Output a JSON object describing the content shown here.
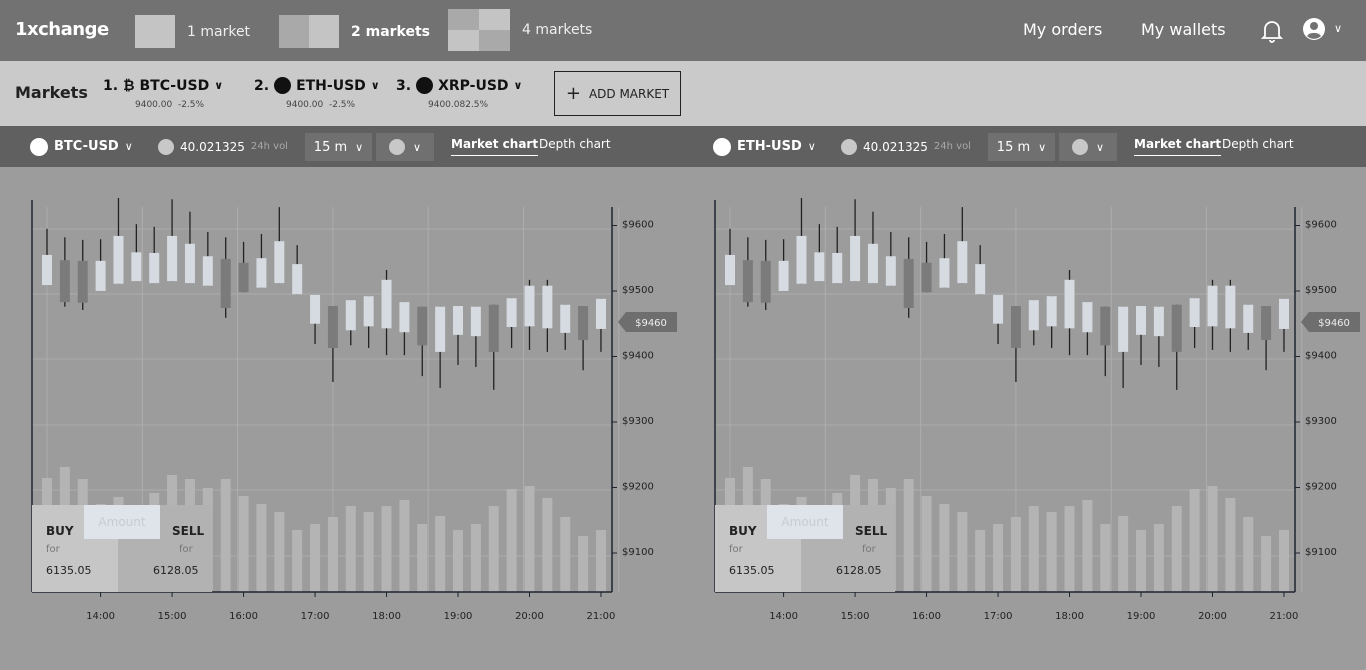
{
  "app": {
    "title": "1xchange"
  },
  "layouts": [
    {
      "label": "1 market"
    },
    {
      "label": "2 markets",
      "active": true
    },
    {
      "label": "4 markets"
    }
  ],
  "nav": {
    "orders": "My orders",
    "wallets": "My wallets",
    "bell_icon": "bell-icon",
    "user_icon": "user-circle-icon"
  },
  "markets": {
    "title": "Markets",
    "items": [
      {
        "index": "1.",
        "icon": "bitcoin-icon",
        "symbol": "₿",
        "pair": "BTC-USD",
        "price": "9400.00",
        "change": "-2.5%"
      },
      {
        "index": "2.",
        "icon": "coin-dot-icon",
        "pair": "ETH-USD",
        "price": "9400.00",
        "change": "-2.5%"
      },
      {
        "index": "3.",
        "icon": "coin-dot-icon",
        "pair": "XRP-USD",
        "price": "9400.08",
        "change": "2.5%"
      }
    ],
    "add_label": "ADD MARKET"
  },
  "colors": {
    "topbar": "#727272",
    "markets_bar": "#cacaca",
    "chart_header": "#606060",
    "background": "#9c9c9c",
    "up_candle": "#d5dbe0",
    "down_candle": "#7b7b7b"
  },
  "panels": [
    {
      "pair": "BTC-USD",
      "volume": "40.021325",
      "volume_label": "24h vol",
      "interval": "15 m",
      "tabs": [
        "Market chart",
        "Depth chart"
      ],
      "active_tab": "Market chart",
      "trade": {
        "buy": "BUY",
        "sell": "SELL",
        "for": "for",
        "buy_price": "6135.05",
        "sell_price": "6128.05",
        "amount_placeholder": "Amount"
      }
    },
    {
      "pair": "ETH-USD",
      "volume": "40.021325",
      "volume_label": "24h vol",
      "interval": "15 m",
      "tabs": [
        "Market chart",
        "Depth chart"
      ],
      "active_tab": "Market chart",
      "trade": {
        "buy": "BUY",
        "sell": "SELL",
        "for": "for",
        "buy_price": "6135.05",
        "sell_price": "6128.05",
        "amount_placeholder": "Amount"
      }
    }
  ],
  "chart_data": [
    {
      "type": "candlestick",
      "pair": "BTC-USD",
      "interval": "15m",
      "current_price_label": "$9460",
      "current_price": 9460,
      "y_ticks": [
        "$9600",
        "$9500",
        "$9400",
        "$9300",
        "$9200",
        "$9100"
      ],
      "y_tick_values": [
        9600,
        9500,
        9400,
        9300,
        9200,
        9100
      ],
      "x_ticks": [
        "14:00",
        "15:00",
        "16:00",
        "17:00",
        "18:00",
        "19:00",
        "20:00",
        "21:00"
      ],
      "first_candle_time": "13:15",
      "grid": true,
      "ohlc": [
        [
          9506,
          9592,
          9506,
          9552
        ],
        [
          9544,
          9579,
          9473,
          9480
        ],
        [
          9543,
          9575,
          9468,
          9479
        ],
        [
          9497,
          9576,
          9497,
          9543
        ],
        [
          9508,
          9639,
          9508,
          9581
        ],
        [
          9512,
          9599,
          9512,
          9556
        ],
        [
          9509,
          9595,
          9509,
          9555
        ],
        [
          9512,
          9637,
          9512,
          9581
        ],
        [
          9509,
          9618,
          9509,
          9569
        ],
        [
          9505,
          9587,
          9505,
          9550
        ],
        [
          9546,
          9579,
          9456,
          9471
        ],
        [
          9540,
          9572,
          9495,
          9495
        ],
        [
          9502,
          9584,
          9502,
          9547
        ],
        [
          9509,
          9625,
          9509,
          9573
        ],
        [
          9492,
          9567,
          9492,
          9538
        ],
        [
          9447,
          9491,
          9416,
          9491
        ],
        [
          9474,
          9474,
          9358,
          9410
        ],
        [
          9437,
          9483,
          9414,
          9483
        ],
        [
          9443,
          9489,
          9410,
          9489
        ],
        [
          9440,
          9529,
          9399,
          9514
        ],
        [
          9434,
          9480,
          9399,
          9480
        ],
        [
          9473,
          9473,
          9367,
          9414
        ],
        [
          9404,
          9473,
          9349,
          9473
        ],
        [
          9430,
          9474,
          9384,
          9474
        ],
        [
          9428,
          9473,
          9381,
          9473
        ],
        [
          9476,
          9476,
          9346,
          9404
        ],
        [
          9442,
          9486,
          9410,
          9486
        ],
        [
          9443,
          9514,
          9407,
          9505
        ],
        [
          9440,
          9514,
          9404,
          9505
        ],
        [
          9433,
          9476,
          9407,
          9476
        ],
        [
          9474,
          9474,
          9376,
          9422
        ],
        [
          9439,
          9485,
          9404,
          9485
        ]
      ],
      "volume": [
        114,
        125,
        113,
        88,
        95,
        87,
        99,
        117,
        113,
        104,
        113,
        96,
        88,
        80,
        62,
        68,
        75,
        86,
        80,
        86,
        92,
        68,
        76,
        62,
        68,
        86,
        103,
        106,
        94,
        75,
        56,
        62
      ]
    },
    {
      "type": "candlestick",
      "pair": "ETH-USD",
      "interval": "15m",
      "current_price_label": "$9460",
      "current_price": 9460,
      "y_ticks": [
        "$9600",
        "$9500",
        "$9400",
        "$9300",
        "$9200",
        "$9100"
      ],
      "y_tick_values": [
        9600,
        9500,
        9400,
        9300,
        9200,
        9100
      ],
      "x_ticks": [
        "14:00",
        "15:00",
        "16:00",
        "17:00",
        "18:00",
        "19:00",
        "20:00",
        "21:00"
      ],
      "first_candle_time": "13:15",
      "grid": true,
      "ohlc": [
        [
          9506,
          9592,
          9506,
          9552
        ],
        [
          9544,
          9579,
          9473,
          9480
        ],
        [
          9543,
          9575,
          9468,
          9479
        ],
        [
          9497,
          9576,
          9497,
          9543
        ],
        [
          9508,
          9639,
          9508,
          9581
        ],
        [
          9512,
          9599,
          9512,
          9556
        ],
        [
          9509,
          9595,
          9509,
          9555
        ],
        [
          9512,
          9637,
          9512,
          9581
        ],
        [
          9509,
          9618,
          9509,
          9569
        ],
        [
          9505,
          9587,
          9505,
          9550
        ],
        [
          9546,
          9579,
          9456,
          9471
        ],
        [
          9540,
          9572,
          9495,
          9495
        ],
        [
          9502,
          9584,
          9502,
          9547
        ],
        [
          9509,
          9625,
          9509,
          9573
        ],
        [
          9492,
          9567,
          9492,
          9538
        ],
        [
          9447,
          9491,
          9416,
          9491
        ],
        [
          9474,
          9474,
          9358,
          9410
        ],
        [
          9437,
          9483,
          9414,
          9483
        ],
        [
          9443,
          9489,
          9410,
          9489
        ],
        [
          9440,
          9529,
          9399,
          9514
        ],
        [
          9434,
          9480,
          9399,
          9480
        ],
        [
          9473,
          9473,
          9367,
          9414
        ],
        [
          9404,
          9473,
          9349,
          9473
        ],
        [
          9430,
          9474,
          9384,
          9474
        ],
        [
          9428,
          9473,
          9381,
          9473
        ],
        [
          9476,
          9476,
          9346,
          9404
        ],
        [
          9442,
          9486,
          9410,
          9486
        ],
        [
          9443,
          9514,
          9407,
          9505
        ],
        [
          9440,
          9514,
          9404,
          9505
        ],
        [
          9433,
          9476,
          9407,
          9476
        ],
        [
          9474,
          9474,
          9376,
          9422
        ],
        [
          9439,
          9485,
          9404,
          9485
        ]
      ],
      "volume": [
        114,
        125,
        113,
        88,
        95,
        87,
        99,
        117,
        113,
        104,
        113,
        96,
        88,
        80,
        62,
        68,
        75,
        86,
        80,
        86,
        92,
        68,
        76,
        62,
        68,
        86,
        103,
        106,
        94,
        75,
        56,
        62
      ]
    }
  ]
}
